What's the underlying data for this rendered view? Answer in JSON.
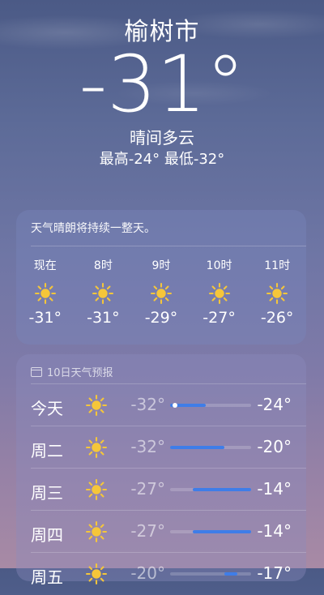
{
  "location": {
    "city": "榆树市",
    "temperature": "-31°",
    "condition": "晴间多云",
    "high_low": "最高-24° 最低-32°"
  },
  "hourly": {
    "summary": "天气晴朗将持续一整天。",
    "items": [
      {
        "time": "现在",
        "icon": "sun-icon",
        "temp": "-31°"
      },
      {
        "time": "8时",
        "icon": "sun-icon",
        "temp": "-31°"
      },
      {
        "time": "9时",
        "icon": "sun-icon",
        "temp": "-29°"
      },
      {
        "time": "10时",
        "icon": "sun-icon",
        "temp": "-27°"
      },
      {
        "time": "11时",
        "icon": "sun-icon",
        "temp": "-26°"
      }
    ]
  },
  "daily": {
    "title": "10日天气预报",
    "range_min": -32,
    "range_max": -14,
    "items": [
      {
        "day": "今天",
        "icon": "sun-icon",
        "low": "-32°",
        "high": "-24°",
        "low_v": -32,
        "high_v": -24,
        "current_v": -31
      },
      {
        "day": "周二",
        "icon": "sun-icon",
        "low": "-32°",
        "high": "-20°",
        "low_v": -32,
        "high_v": -20
      },
      {
        "day": "周三",
        "icon": "sun-icon",
        "low": "-27°",
        "high": "-14°",
        "low_v": -27,
        "high_v": -14
      },
      {
        "day": "周四",
        "icon": "sun-icon",
        "low": "-27°",
        "high": "-14°",
        "low_v": -27,
        "high_v": -14
      },
      {
        "day": "周五",
        "icon": "sun-icon",
        "low": "-20°",
        "high": "-17°",
        "low_v": -20,
        "high_v": -17
      }
    ]
  },
  "colors": {
    "sun": "#f5c63a",
    "range_bar": "#3f7de8"
  }
}
